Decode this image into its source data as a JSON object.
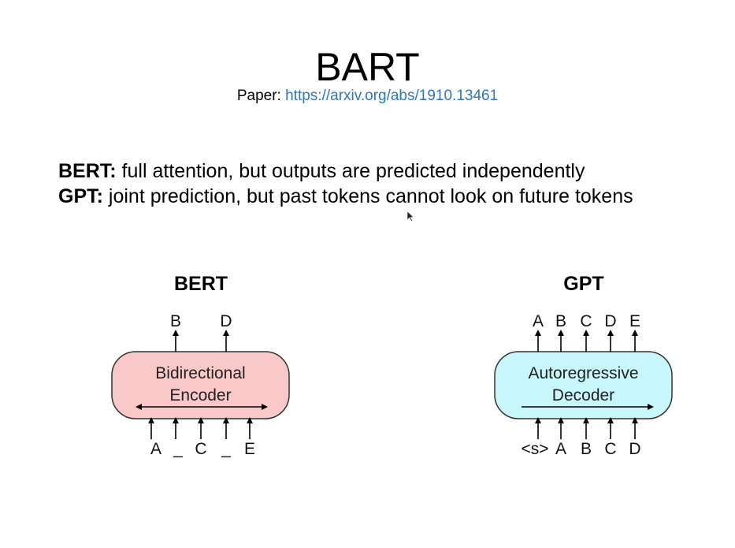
{
  "header": {
    "title": "BART",
    "paper_prefix": "Paper: ",
    "paper_link": "https://arxiv.org/abs/1910.13461"
  },
  "bullets": [
    {
      "term": "BERT:",
      "text": " full attention, but outputs are predicted independently"
    },
    {
      "term": "GPT:",
      "text": " joint prediction, but past tokens cannot look on future tokens"
    }
  ],
  "bert": {
    "title": "BERT",
    "box_line1": "Bidirectional",
    "box_line2": "Encoder",
    "box_color": "#f9c8c8",
    "outputs": [
      "B",
      "D"
    ],
    "inputs": [
      "A",
      "_",
      "C",
      "_",
      "E"
    ]
  },
  "gpt": {
    "title": "GPT",
    "box_line1": "Autoregressive",
    "box_line2": "Decoder",
    "box_color": "#c7f6fb",
    "outputs": [
      "A",
      "B",
      "C",
      "D",
      "E"
    ],
    "inputs": [
      "<s>",
      "A",
      "B",
      "C",
      "D"
    ]
  }
}
